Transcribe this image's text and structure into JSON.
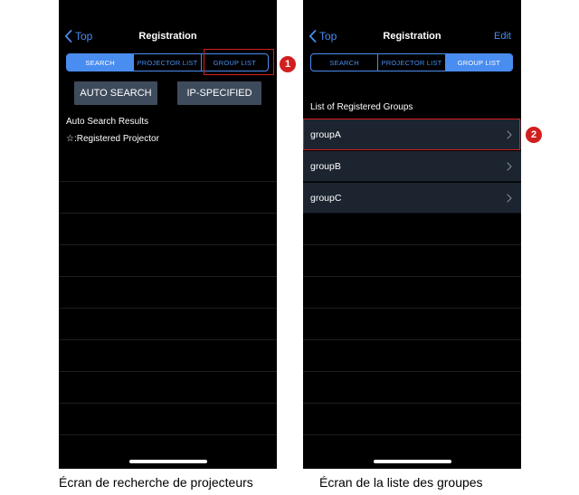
{
  "left_screen": {
    "nav": {
      "back_label": "Top",
      "title": "Registration"
    },
    "tabs": [
      "SEARCH",
      "PROJECTOR LIST",
      "GROUP LIST"
    ],
    "active_tab": "SEARCH",
    "buttons": {
      "auto_search": "AUTO SEARCH",
      "ip_specified": "IP-SPECIFIED"
    },
    "results_heading": "Auto Search Results",
    "legend": "☆:Registered Projector",
    "caption": "Écran de recherche de projecteurs"
  },
  "right_screen": {
    "nav": {
      "back_label": "Top",
      "title": "Registration",
      "edit_label": "Edit"
    },
    "tabs": [
      "SEARCH",
      "PROJECTOR LIST",
      "GROUP LIST"
    ],
    "active_tab": "GROUP LIST",
    "list_heading": "List of Registered Groups",
    "groups": [
      "groupA",
      "groupB",
      "groupC"
    ],
    "caption": "Écran de la liste des groupes"
  },
  "annotations": {
    "marker_1": "1",
    "marker_2": "2"
  },
  "colors": {
    "accent": "#4a8df0",
    "highlight": "#d11f1f",
    "row_bg": "#1c2430",
    "button_bg": "#3e4b5c"
  }
}
